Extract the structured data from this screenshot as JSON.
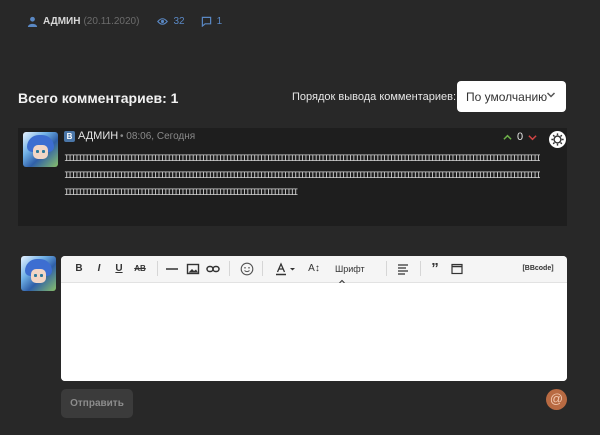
{
  "meta": {
    "author": "АДМИН",
    "date": "(20.11.2020)",
    "views": "32",
    "comments": "1"
  },
  "header": {
    "total_label": "Всего комментариев:",
    "total_count": "1",
    "order_label": "Порядок вывода комментариев:",
    "order_value": "По умолчанию"
  },
  "comment": {
    "badge": "В",
    "author": "АДМИН",
    "time": "• 08:06, Сегодня",
    "rating": "0",
    "text": "IIIIIIIIIIIIIIIIIIIIIIIIIIIIIIIIIIIIIIIIIIIIIIIIIIIIIIIIIIIIIIIIIIIIIIIIIIIIIIIIIIIIIIIIIIIIIIIIIIIIIIIIIIIIIIIIIIIIIIIIIIIIIIIIIIIIIIIIIIIIIIIIIIIIIIIIIIIIIIIIIIIIIIIIIIIIIIIIIIIIIIIIIIIIIIIIIIIIIIIIIIIIIIIIIIIIIIIIIIIIIIIIIIIIIIIIIIIIIIIIIIIIIIIIIIIIIIIIIIIIIIIIIIIIIIIIIIIIIIIIIIIIIIIIIIIIIIIIIIIIIIIIIIIIIIIIIIIIIIIIIIIIIIIIIIIIIIIIIIIIIIIIII"
  },
  "editor": {
    "bold": "B",
    "italic": "I",
    "underline": "U",
    "strike": "AB",
    "font_size": "A↕",
    "font_label": "Шрифт",
    "quote": "”",
    "bbcode": "[BBcode]"
  },
  "actions": {
    "send": "Отправить",
    "mention": "@"
  },
  "colors": {
    "background": "#282828",
    "card": "#1e1e1e",
    "accent_blue": "#5a88c4",
    "vote_up": "#6fb24a",
    "vote_down": "#d04545"
  }
}
